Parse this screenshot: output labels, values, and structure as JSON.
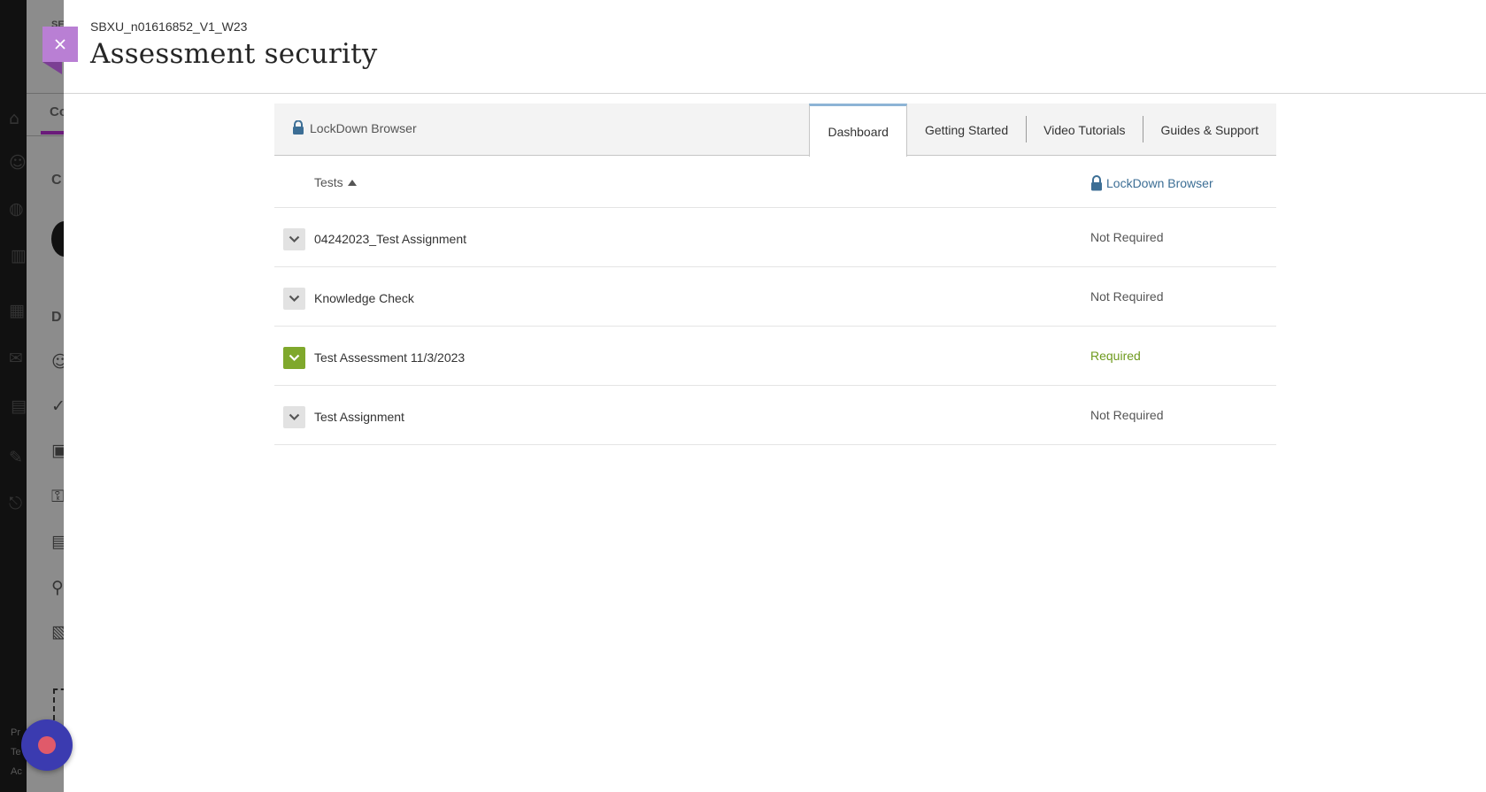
{
  "header": {
    "course_id": "SBXU_n01616852_V1_W23",
    "title": "Assessment security"
  },
  "lockdown": {
    "brand": "LockDown Browser",
    "tabs": [
      {
        "label": "Dashboard",
        "active": true
      },
      {
        "label": "Getting Started",
        "active": false
      },
      {
        "label": "Video Tutorials",
        "active": false
      },
      {
        "label": "Guides & Support",
        "active": false
      }
    ],
    "columns": {
      "tests": "Tests",
      "lockdown": "LockDown Browser"
    },
    "rows": [
      {
        "name": "04242023_Test Assignment",
        "status": "Not Required",
        "expanded": false
      },
      {
        "name": "Knowledge Check",
        "status": "Not Required",
        "expanded": false
      },
      {
        "name": "Test Assessment 11/3/2023",
        "status": "Required",
        "expanded": false
      },
      {
        "name": "Test Assignment",
        "status": "Not Required",
        "expanded": false
      }
    ]
  },
  "background": {
    "tab_partial": "Co",
    "heading_partial_1": "C",
    "heading_partial_2": "D",
    "footer_partial": [
      "Pr",
      "Te",
      "Ac"
    ],
    "top_partial": "SE"
  },
  "icons": [
    "close-icon",
    "lock-icon",
    "sort-ascending-icon",
    "chevron-down-icon",
    "record-icon"
  ],
  "colors": {
    "accent_purple": "#b97fd4",
    "required_green": "#6e9a1e",
    "link_blue": "#3c6e95",
    "active_tab_border": "#8db4d6"
  }
}
